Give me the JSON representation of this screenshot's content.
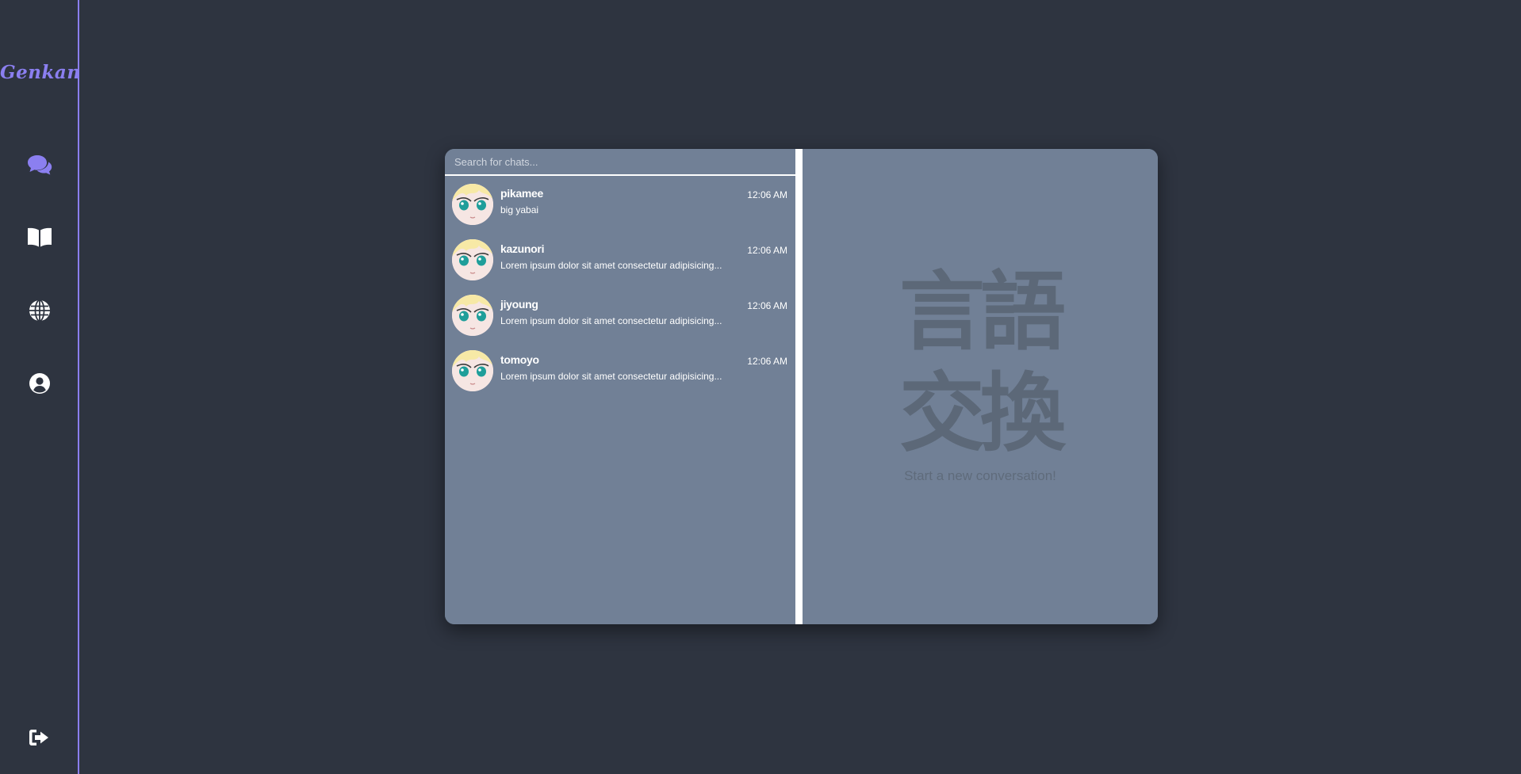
{
  "app": {
    "logo": "Genkan"
  },
  "sidebar": {
    "items": [
      {
        "name": "chats",
        "icon": "comments-icon",
        "color": "#8b7ff0"
      },
      {
        "name": "learn",
        "icon": "book-open-icon",
        "color": "#ffffff"
      },
      {
        "name": "explore",
        "icon": "globe-icon",
        "color": "#ffffff"
      },
      {
        "name": "profile",
        "icon": "user-circle-icon",
        "color": "#ffffff"
      }
    ],
    "logout_icon": "sign-out-icon"
  },
  "search": {
    "placeholder": "Search for chats..."
  },
  "chats": [
    {
      "name": "pikamee",
      "preview": "big yabai",
      "time": "12:06 AM"
    },
    {
      "name": "kazunori",
      "preview": "Lorem ipsum dolor sit amet consectetur adipisicing...",
      "time": "12:06 AM"
    },
    {
      "name": "jiyoung",
      "preview": "Lorem ipsum dolor sit amet consectetur adipisicing...",
      "time": "12:06 AM"
    },
    {
      "name": "tomoyo",
      "preview": "Lorem ipsum dolor sit amet consectetur adipisicing...",
      "time": "12:06 AM"
    }
  ],
  "conversation": {
    "kanji_line1": "言語",
    "kanji_line2": "交換",
    "empty_message": "Start a new conversation!"
  },
  "colors": {
    "background": "#2e3440",
    "accent": "#8b7ff0",
    "panel": "#718096"
  }
}
